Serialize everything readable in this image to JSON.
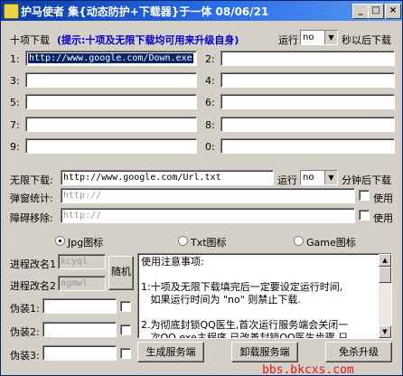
{
  "window": {
    "title": "护马使者 集{动态防护+下载器}于一体 08/06/21"
  },
  "ten_download": {
    "label": "十项下载",
    "hint": "(提示:十项及无限下载均可用来升级自身)",
    "run_label": "运行",
    "run_value": "no",
    "after_label": "秒以后下载",
    "slots": [
      {
        "label": "1:",
        "value": "http://www.google.com/Down.exe"
      },
      {
        "label": "2:",
        "value": ""
      },
      {
        "label": "3:",
        "value": ""
      },
      {
        "label": "4:",
        "value": ""
      },
      {
        "label": "5:",
        "value": ""
      },
      {
        "label": "6:",
        "value": ""
      },
      {
        "label": "7:",
        "value": ""
      },
      {
        "label": "8:",
        "value": ""
      },
      {
        "label": "9:",
        "value": ""
      },
      {
        "label": "0:",
        "value": ""
      }
    ]
  },
  "unlimited": {
    "label": "无限下载:",
    "value": "http://www.google.com/Url.txt",
    "run_label": "运行",
    "run_value": "no",
    "after_label": "分钟后下载"
  },
  "popup_stats": {
    "label": "弹窗统计:",
    "placeholder": "http://",
    "use_label": "使用"
  },
  "obstacle_remove": {
    "label": "障碍移除:",
    "placeholder": "http://",
    "use_label": "使用"
  },
  "icons": {
    "options": [
      "Jpg图标",
      "Txt图标",
      "Game图标"
    ],
    "selected": "Jpg图标"
  },
  "process1": {
    "label": "进程改名1",
    "value": "kcyql"
  },
  "process2": {
    "label": "进程改名2",
    "value": "agmwl"
  },
  "random_button": "随机",
  "disguise": [
    {
      "label": "伪装1:",
      "value": ""
    },
    {
      "label": "伪装2:",
      "value": ""
    },
    {
      "label": "伪装3:",
      "value": ""
    }
  ],
  "notes": {
    "text": "使用注意事项:\n\n1:十项及无限下载填完后一定要设定运行时间,\n   如果运行时间为 \"no\" 则禁止下载.\n\n2.为彻底封锁QQ医生,首次运行服务端会关闭一\n   次QQ.exe主程序,已改善封锁QQ医生步骤,只"
  },
  "buttons": {
    "generate": "生成服务端",
    "uninstall": "卸载服务端",
    "upgrade": "免杀升级"
  },
  "watermark": "bbs.bkcxs.com"
}
